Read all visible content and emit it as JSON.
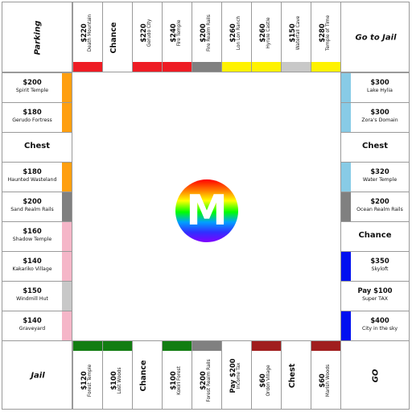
{
  "colors": {
    "orange": "#ff9f10",
    "red": "#ee1c24",
    "yellow": "#fff200",
    "gray": "#808080",
    "lightgray": "#c8c8c8",
    "lightblue": "#88cbe6",
    "blue": "#0010f0",
    "pink": "#f5b6c8",
    "green": "#127d12",
    "brown": "#a01e1e"
  },
  "corners": {
    "top_left": "Parking",
    "top_right": "Go to Jail",
    "bottom_left": "Jail",
    "bottom_right": "GO"
  },
  "logo": {
    "letter": "M"
  },
  "top": [
    {
      "price": "$220",
      "name": "Death Mountain",
      "color": "red"
    },
    {
      "big": "Chance"
    },
    {
      "price": "$220",
      "name": "Gerudo City",
      "color": "red"
    },
    {
      "price": "$240",
      "name": "Fire Temple",
      "color": "red"
    },
    {
      "price": "$200",
      "name": "Fire Realm Rails",
      "color": "gray"
    },
    {
      "price": "$260",
      "name": "Lon Lon Ranch",
      "color": "yellow"
    },
    {
      "price": "$260",
      "name": "Hyrule Castle",
      "color": "yellow"
    },
    {
      "price": "$150",
      "name": "Waterfall Cave",
      "color": "lightgray"
    },
    {
      "price": "$280",
      "name": "Temple of Time",
      "color": "yellow"
    }
  ],
  "left": [
    {
      "price": "$200",
      "name": "Spirit Temple",
      "color": "orange"
    },
    {
      "price": "$180",
      "name": "Gerudo Fortress",
      "color": "orange"
    },
    {
      "big": "Chest"
    },
    {
      "price": "$180",
      "name": "Haunted Wasteland",
      "color": "orange"
    },
    {
      "price": "$200",
      "name": "Sand Realm Rails",
      "color": "gray"
    },
    {
      "price": "$160",
      "name": "Shadow Temple",
      "color": "pink"
    },
    {
      "price": "$140",
      "name": "Kakariko Village",
      "color": "pink"
    },
    {
      "price": "$150",
      "name": "Windmill Hut",
      "color": "lightgray"
    },
    {
      "price": "$140",
      "name": "Graveyard",
      "color": "pink"
    }
  ],
  "right": [
    {
      "price": "$300",
      "name": "Lake Hylia",
      "color": "lightblue"
    },
    {
      "price": "$300",
      "name": "Zora's Domain",
      "color": "lightblue"
    },
    {
      "big": "Chest"
    },
    {
      "price": "$320",
      "name": "Water Temple",
      "color": "lightblue"
    },
    {
      "price": "$200",
      "name": "Ocean Realm Rails",
      "color": "gray"
    },
    {
      "big": "Chance"
    },
    {
      "price": "$350",
      "name": "Skyloft",
      "color": "blue"
    },
    {
      "price": "Pay $100",
      "name": "Super TAX"
    },
    {
      "price": "$400",
      "name": "City in the sky",
      "color": "blue"
    }
  ],
  "bottom": [
    {
      "price": "$120",
      "name": "Forest Temple",
      "color": "green"
    },
    {
      "price": "$100",
      "name": "Lost Woods",
      "color": "green"
    },
    {
      "big": "Chance"
    },
    {
      "price": "$100",
      "name": "Kokiri Forest",
      "color": "green"
    },
    {
      "price": "$200",
      "name": "Forest Realm Rails",
      "color": "gray"
    },
    {
      "price": "Pay $200",
      "name": "Income Tax"
    },
    {
      "price": "$60",
      "name": "Ordon Village",
      "color": "brown"
    },
    {
      "big": "Chest"
    },
    {
      "price": "$60",
      "name": "Marish Woods",
      "color": "brown"
    }
  ]
}
